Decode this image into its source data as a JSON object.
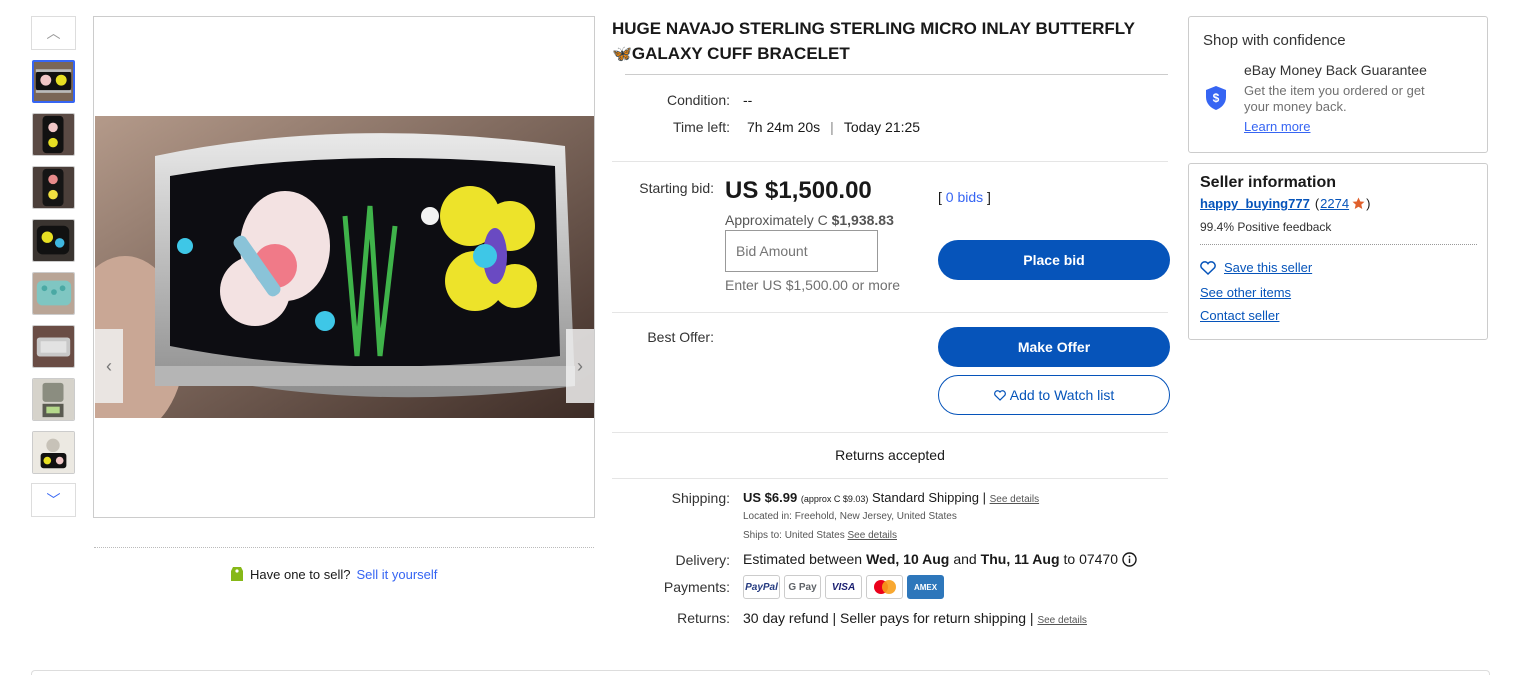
{
  "thumbnails": {
    "up_arrow": "︿",
    "down_arrow": "﹀",
    "items": [
      {
        "name": "thumb-1",
        "color": "#2b2b3a"
      },
      {
        "name": "thumb-2",
        "color": "#5a4a44"
      },
      {
        "name": "thumb-3",
        "color": "#4b3f3a"
      },
      {
        "name": "thumb-4",
        "color": "#3a3430"
      },
      {
        "name": "thumb-5",
        "color": "#7fb3b0"
      },
      {
        "name": "thumb-6",
        "color": "#6a4d45"
      },
      {
        "name": "thumb-7",
        "color": "#888a7c"
      },
      {
        "name": "thumb-8",
        "color": "#d8d4cc"
      }
    ]
  },
  "gallery": {
    "prev_arrow": "‹",
    "next_arrow": "›"
  },
  "sell": {
    "question": "Have one to sell?",
    "link": "Sell it yourself"
  },
  "item": {
    "title_line1": "HUGE NAVAJO STERLING STERLING MICRO INLAY BUTTERFLY",
    "title_emoji": "🦋",
    "title_line2": "GALAXY CUFF BRACELET",
    "condition_label": "Condition:",
    "condition_value": "--",
    "time_left_label": "Time left:",
    "time_left_value": "7h 24m 20s",
    "time_separator": "|",
    "time_end": "Today 21:25",
    "starting_bid_label": "Starting bid:",
    "price": "US $1,500.00",
    "approx_label": "Approximately C",
    "approx_value": "$1,938.83",
    "bids_open": "[",
    "bids_link": "0 bids",
    "bids_close": "]",
    "bid_placeholder": "Bid Amount",
    "bid_hint": "Enter US $1,500.00 or more",
    "place_bid": "Place bid",
    "best_offer_label": "Best Offer:",
    "make_offer": "Make Offer",
    "watch": "Add to Watch list",
    "returns_accepted": "Returns accepted"
  },
  "shipping": {
    "label": "Shipping:",
    "price": "US $6.99",
    "approx": "(approx C $9.03)",
    "method": "Standard Shipping |",
    "see_details": "See details",
    "located": "Located in: Freehold, New Jersey, United States",
    "ships_to": "Ships to: United States",
    "ships_see_details": "See details",
    "delivery_label": "Delivery:",
    "delivery_prefix": "Estimated between",
    "delivery_start": "Wed, 10 Aug",
    "delivery_and": "and",
    "delivery_end": "Thu, 11 Aug",
    "delivery_suffix": "to 07470",
    "payments_label": "Payments:",
    "payments": [
      "PayPal",
      "G Pay",
      "VISA",
      "",
      "AMEX"
    ],
    "returns_label": "Returns:",
    "returns_value": "30 day refund | Seller pays for return shipping |",
    "returns_see_details": "See details"
  },
  "confidence": {
    "title": "Shop with confidence",
    "guarantee_title": "eBay Money Back Guarantee",
    "guarantee_line1": "Get the item you ordered or get",
    "guarantee_line2": "your money back.",
    "learn_more": "Learn more",
    "shield_glyph": "$"
  },
  "seller": {
    "title": "Seller information",
    "name": "happy_buying777",
    "score_open": "(",
    "score": "2274",
    "score_close": ")",
    "feedback": "99.4% Positive feedback",
    "save": "Save this seller",
    "other_items": "See other items",
    "contact": "Contact seller"
  },
  "colors": {
    "link": "#3665f3",
    "button": "#0654ba",
    "star": "#e0602c"
  }
}
